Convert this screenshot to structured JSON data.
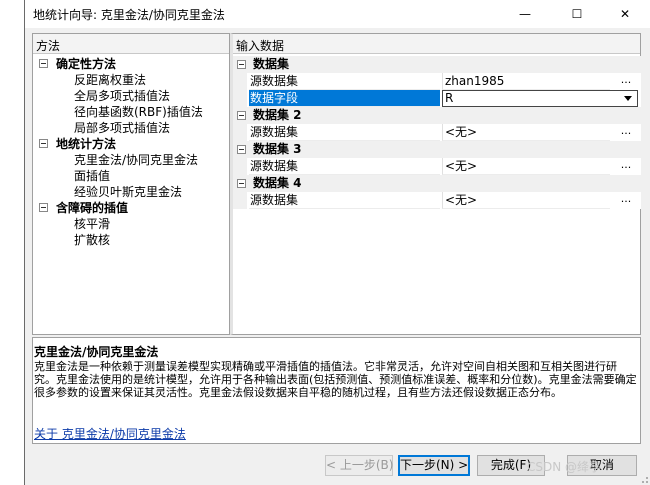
{
  "window": {
    "title": "地统计向导: 克里金法/协同克里金法",
    "min_glyph": "—",
    "max_glyph": "☐",
    "close_glyph": "✕"
  },
  "methods_pane": {
    "header": "方法",
    "groups": [
      {
        "label": "确定性方法",
        "items": [
          "反距离权重法",
          "全局多项式插值法",
          "径向基函数(RBF)插值法",
          "局部多项式插值法"
        ]
      },
      {
        "label": "地统计方法",
        "items": [
          "克里金法/协同克里金法",
          "面插值",
          "经验贝叶斯克里金法"
        ]
      },
      {
        "label": "含障碍的插值",
        "items": [
          "核平滑",
          "扩散核"
        ]
      }
    ],
    "selected_item": "克里金法/协同克里金法"
  },
  "input_pane": {
    "header": "输入数据",
    "sections": [
      {
        "label": "数据集",
        "props": [
          {
            "name": "源数据集",
            "value": "zhan1985",
            "button": "..."
          },
          {
            "name": "数据字段",
            "value": "R",
            "selected": true
          }
        ]
      },
      {
        "label": "数据集 2",
        "props": [
          {
            "name": "源数据集",
            "value": "<无>",
            "button": "..."
          }
        ]
      },
      {
        "label": "数据集 3",
        "props": [
          {
            "name": "源数据集",
            "value": "<无>",
            "button": "..."
          }
        ]
      },
      {
        "label": "数据集 4",
        "props": [
          {
            "name": "源数据集",
            "value": "<无>",
            "button": "..."
          }
        ]
      }
    ]
  },
  "description": {
    "title": "克里金法/协同克里金法",
    "body": "克里金法是一种依赖于测量误差模型实现精确或平滑插值的插值法。它非常灵活，允许对空间自相关图和互相关图进行研究。克里金法使用的是统计模型，允许用于各种输出表面(包括预测值、预测值标准误差、概率和分位数)。克里金法需要确定很多参数的设置来保证其灵活性。克里金法假设数据来自平稳的随机过程，且有些方法还假设数据正态分布。",
    "link": "关于 克里金法/协同克里金法"
  },
  "buttons": {
    "back": "< 上一步(B)",
    "next": "下一步(N) >",
    "finish": "完成(F)",
    "cancel": "取消"
  },
  "watermark": "CSDN @绛亭"
}
